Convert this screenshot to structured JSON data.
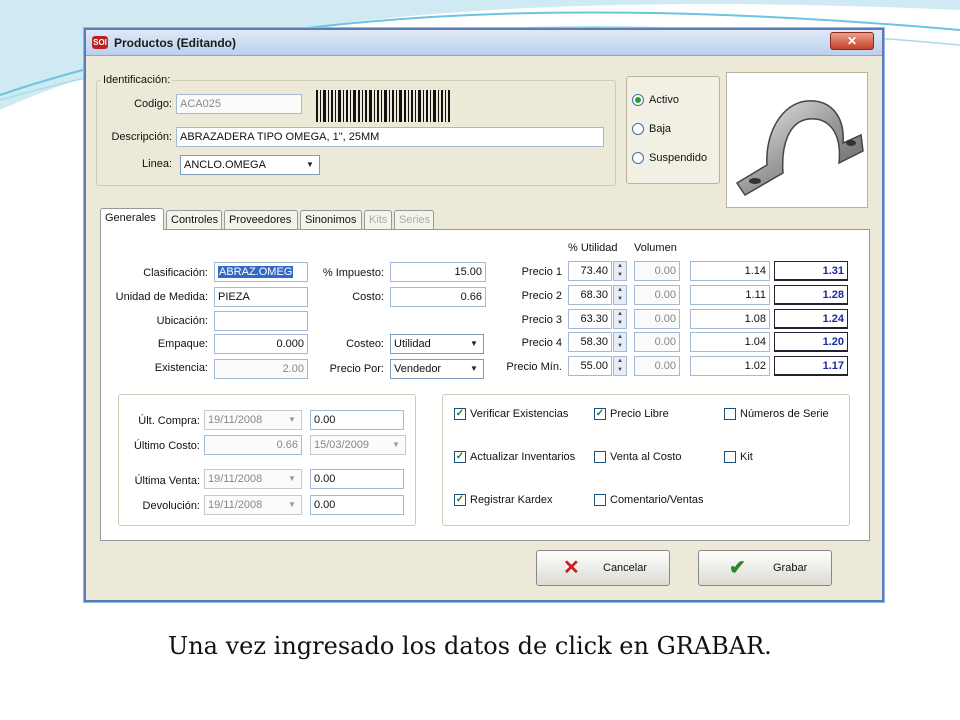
{
  "window": {
    "title": "Productos (Editando)",
    "close_glyph": "✕"
  },
  "identificacion": {
    "group_label": "Identificación:",
    "codigo_label": "Codigo:",
    "codigo_value": "ACA025",
    "descripcion_label": "Descripción:",
    "descripcion_value": "ABRAZADERA TIPO OMEGA, 1\", 25MM",
    "linea_label": "Linea:",
    "linea_value": "ANCLO.OMEGA"
  },
  "estado": {
    "options": [
      "Activo",
      "Baja",
      "Suspendido"
    ],
    "selected": "Activo"
  },
  "tabs": [
    "Generales",
    "Controles",
    "Proveedores",
    "Sinonimos",
    "Kits",
    "Series"
  ],
  "generales": {
    "clasificacion_label": "Clasificación:",
    "clasificacion_value": "ABRAZ.OMEG",
    "unidad_label": "Unidad de Medida:",
    "unidad_value": "PIEZA",
    "ubicacion_label": "Ubicación:",
    "ubicacion_value": "",
    "empaque_label": "Empaque:",
    "empaque_value": "0.000",
    "existencia_label": "Existencia:",
    "existencia_value": "2.00",
    "impuesto_label": "% Impuesto:",
    "impuesto_value": "15.00",
    "costo_label": "Costo:",
    "costo_value": "0.66",
    "costeo_label": "Costeo:",
    "costeo_value": "Utilidad",
    "precio_por_label": "Precio Por:",
    "precio_por_value": "Vendedor"
  },
  "precios": {
    "header_utilidad": "% Utilidad",
    "header_volumen": "Volumen",
    "rows": [
      {
        "label": "Precio 1",
        "utilidad": "73.40",
        "volumen": "0.00",
        "precio": "1.14",
        "total": "1.31"
      },
      {
        "label": "Precio 2",
        "utilidad": "68.30",
        "volumen": "0.00",
        "precio": "1.11",
        "total": "1.28"
      },
      {
        "label": "Precio 3",
        "utilidad": "63.30",
        "volumen": "0.00",
        "precio": "1.08",
        "total": "1.24"
      },
      {
        "label": "Precio 4",
        "utilidad": "58.30",
        "volumen": "0.00",
        "precio": "1.04",
        "total": "1.20"
      },
      {
        "label": "Precio Mín.",
        "utilidad": "55.00",
        "volumen": "0.00",
        "precio": "1.02",
        "total": "1.17"
      }
    ]
  },
  "historial": {
    "ult_compra_label": "Últ. Compra:",
    "ult_compra_fecha": "19/11/2008",
    "ult_compra_valor": "0.00",
    "ultimo_costo_label": "Último Costo:",
    "ultimo_costo_valor": "0.66",
    "ultimo_costo_fecha": "15/03/2009",
    "ultima_venta_label": "Última Venta:",
    "ultima_venta_fecha": "19/11/2008",
    "ultima_venta_valor": "0.00",
    "devolucion_label": "Devolución:",
    "devolucion_fecha": "19/11/2008",
    "devolucion_valor": "0.00"
  },
  "opciones": [
    {
      "label": "Verificar Existencias",
      "checked": true
    },
    {
      "label": "Precio Libre",
      "checked": true
    },
    {
      "label": "Números de Serie",
      "checked": false
    },
    {
      "label": "Actualizar Inventarios",
      "checked": true
    },
    {
      "label": "Venta al Costo",
      "checked": false
    },
    {
      "label": "Kit",
      "checked": false
    },
    {
      "label": "Registrar Kardex",
      "checked": true
    },
    {
      "label": "Comentario/Ventas",
      "checked": false
    }
  ],
  "buttons": {
    "cancel": "Cancelar",
    "save": "Grabar"
  },
  "caption": "Una vez ingresado los datos de click en GRABAR.",
  "colors": {
    "accent_blue": "#1a2aa0",
    "window_bg": "#ece9d8"
  },
  "icons": {
    "cancel": "red-x-icon",
    "save": "green-check-icon",
    "app": "app-logo-icon"
  }
}
